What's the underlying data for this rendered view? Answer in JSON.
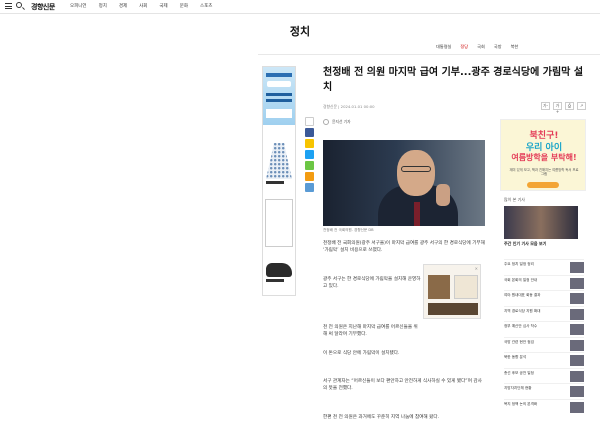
{
  "header": {
    "logo": "경향신문",
    "gnb": [
      "오피니언",
      "정치",
      "경제",
      "사회",
      "국제",
      "문화",
      "스포츠"
    ]
  },
  "section": {
    "title": "정치",
    "subnav": [
      "대통령실",
      "정당",
      "국회",
      "국방",
      "북한"
    ],
    "active_index": 1
  },
  "article": {
    "headline": "천정배 전 의원 마지막 급여 기부...광주 경로식당에 가림막 설치",
    "byline": "경향신문 | 2024.01.01 00:00",
    "tools": [
      "가-",
      "가+",
      "⎙",
      "↗"
    ],
    "author": "윤지선 기자",
    "photo_caption": "천정배 전 국회의원. 경향신문 DB",
    "paragraphs": [
      "천정배 전 국회의원(광주 서구을)이 마지막 급여를 광주 서구의 한 경로식당에 기부해 ‘가림막’ 설치 비용으로 쓰였다.",
      "광주 서구는 한 경로식당에 가림막을 설치해 운영하고 있다.",
      "천 전 의원은 지난해 마지막 급여를 어르신들을 위해 써 달라며 기부했다.",
      "이 돈으로 식당 안에 가림막이 설치됐다.",
      "서구 관계자는 “어르신들이 보다 편안하고 안전하게 식사하실 수 있게 됐다”며 감사의 뜻을 전했다.",
      "한편 천 전 의원은 과거에도 꾸준히 지역 나눔에 참여해 왔다."
    ]
  },
  "ads": {
    "right_banner": {
      "line1": "북친구!",
      "line2": "우리 아이",
      "line3": "여름방학을 부탁해!",
      "subtext": "재미 있게 보고, 책과 친해지는 여름방학 독서 프로그램"
    }
  },
  "sidebar": {
    "section_label": "많이 본 기사",
    "feature_caption": "주간 인기 기사 모음 보기",
    "news": [
      "주요 정치 일정 정리",
      "국회 본회의 일정 안내",
      "여야 원내대표 회동 결과",
      "지역 경로식당 지원 확대",
      "정부 예산안 심사 착수",
      "국방 관련 현안 점검",
      "북한 동향 분석",
      "총선 후보 공천 일정",
      "지방자치단체 현황",
      "복지 정책 논의 본격화"
    ]
  },
  "colors": {
    "accent": "#c00000",
    "share": [
      "#3b5998",
      "#f7c400",
      "#1da1f2",
      "#6cc644",
      "#f39c12",
      "#5a9bd5",
      "#666666"
    ]
  }
}
